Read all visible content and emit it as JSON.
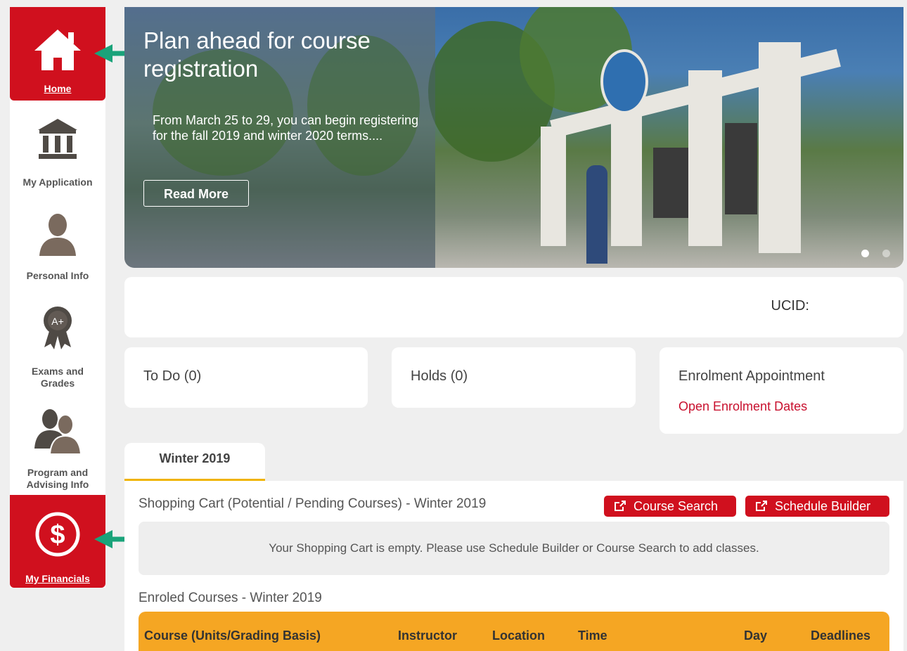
{
  "sidebar": {
    "items": [
      {
        "label": "Home",
        "icon": "home-icon"
      },
      {
        "label": "My Application",
        "icon": "bank-icon"
      },
      {
        "label": "Personal Info",
        "icon": "person-icon"
      },
      {
        "label_line1": "Exams and",
        "label_line2": "Grades",
        "icon": "award-ribbon-icon"
      },
      {
        "label_line1": "Program and",
        "label_line2": "Advising Info",
        "icon": "people-icon"
      },
      {
        "label": "My Financials",
        "icon": "dollar-circle-icon"
      }
    ]
  },
  "banner": {
    "title": "Plan ahead for course registration",
    "text": "From March 25 to 29, you can begin registering for the fall 2019 and winter 2020 terms....",
    "button": "Read More"
  },
  "user": {
    "ucid_label": "UCID:"
  },
  "cards": {
    "todo": "To Do (0)",
    "holds": "Holds (0)",
    "enrolment_title": "Enrolment Appointment",
    "enrolment_link": "Open Enrolment Dates"
  },
  "term_tab": "Winter 2019",
  "shopping_cart": {
    "title": "Shopping Cart (Potential / Pending Courses) - Winter 2019",
    "course_search": "Course Search",
    "schedule_builder": "Schedule Builder",
    "empty_message": "Your Shopping Cart is empty. Please use Schedule Builder or Course Search to add classes."
  },
  "enrolled": {
    "title": "Enroled Courses - Winter 2019",
    "columns": [
      "Course (Units/Grading Basis)",
      "Instructor",
      "Location",
      "Time",
      "Day",
      "Deadlines"
    ]
  },
  "colors": {
    "brand_red": "#d0101e",
    "tab_accent": "#f0b400",
    "table_header": "#f5a623",
    "arrow": "#1aa37a"
  }
}
